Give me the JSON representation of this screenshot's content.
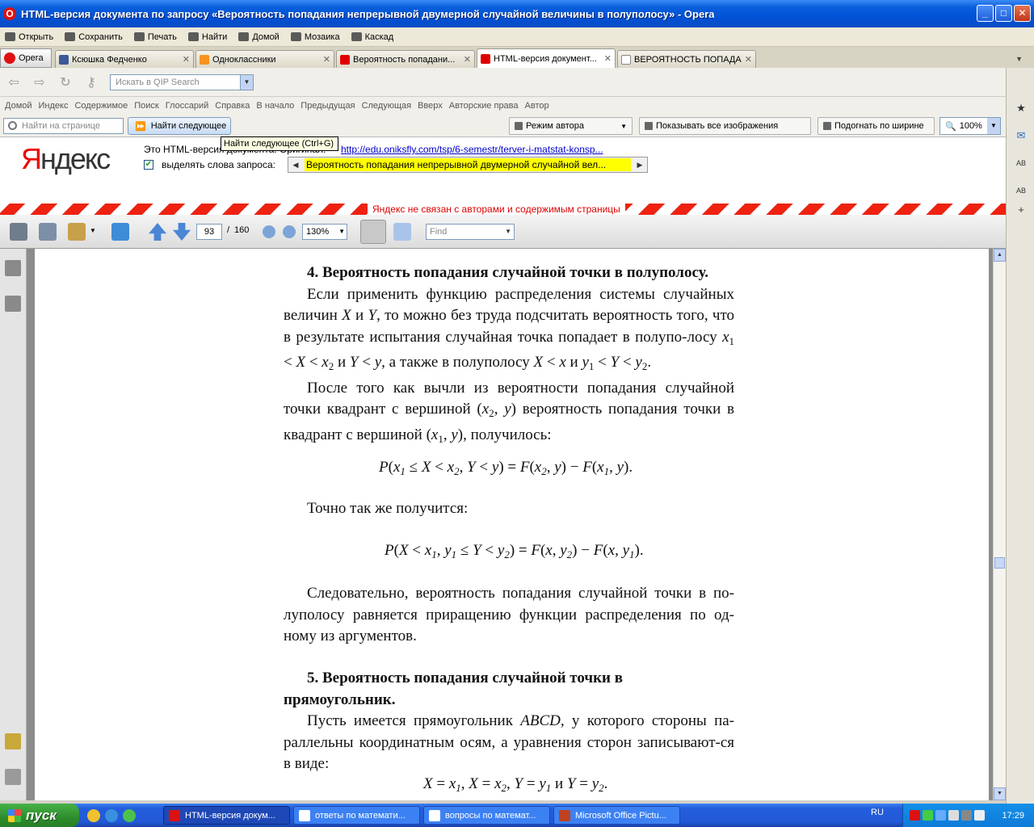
{
  "window": {
    "title": "HTML-версия документа по запросу «Вероятность попадания непрерывной двумерной случайной величины в полуполосу» - Opera"
  },
  "menubar": {
    "items": [
      "Открыть",
      "Сохранить",
      "Печать",
      "Найти",
      "Домой",
      "Мозаика",
      "Каскад"
    ]
  },
  "tabs": {
    "opera_label": "Opera",
    "items": [
      {
        "label": "Ксюшка Федченко",
        "color": "#3b5998"
      },
      {
        "label": "Одноклассники",
        "color": "#f7931e"
      },
      {
        "label": "Вероятность попадани...",
        "color": "#e00000"
      },
      {
        "label": "HTML-версия документ...",
        "color": "#e00000"
      },
      {
        "label": "ВЕРОЯТНОСТЬ ПОПАДА...",
        "color": "#888888"
      }
    ]
  },
  "navbar": {
    "search_placeholder": "Искать в QIP Search"
  },
  "sitelinks": [
    "Домой",
    "Индекс",
    "Содержимое",
    "Поиск",
    "Глоссарий",
    "Справка",
    "В начало",
    "Предыдущая",
    "Следующая",
    "Вверх",
    "Авторские права",
    "Автор"
  ],
  "findbar": {
    "placeholder": "Найти на странице",
    "find_next": "Найти следующее",
    "tooltip": "Найти следующее (Ctrl+G)",
    "author_mode": "Режим автора",
    "show_images": "Показывать все изображения",
    "fit_width": "Подогнать по ширине",
    "zoom": "100%"
  },
  "yandex": {
    "logo_r": "Я",
    "logo_rest": "ндекс",
    "html_version_text": "Это HTML-версия документа. Оригинал:",
    "url": "http://edu.oniksfly.com/tsp/6-semestr/terver-i-matstat-konsp...",
    "highlight_label": "выделять слова запроса:",
    "query": "Вероятность попадания непрерывной двумерной случайной вел...",
    "disclaimer": "Яндекс не связан с авторами и содержимым страницы"
  },
  "pdf": {
    "page": "93",
    "separator": "/",
    "total": "160",
    "zoom": "130%",
    "find_placeholder": "Find"
  },
  "document": {
    "heading4": "4. Вероятность попадания случайной точки в полуполосу.",
    "p1": "Если применить функцию распределения системы случайных величин",
    "p1_b": "и",
    "p1_c": ", то можно без труда подсчитать вероятность того, что в результате испытания случайная точка попадает в полупо-лосу",
    "p1_d": ", а также в полуполосу",
    "p2": "После того как вычли из вероятности попадания случайной точки квадрант с вершиной",
    "p2_b": "вероятность попадания точки в квадрант с вершиной",
    "p2_c": ", получилось:",
    "p3": "Точно так же получится:",
    "p4": "Следовательно, вероятность попадания случайной точки в по-луполосу равняется приращению функции распределения по од-ному из аргументов.",
    "heading5": "5. Вероятность попадания случайной точки в прямоугольник.",
    "p5_a": "Пусть имеется прямоугольник",
    "p5_abcd": "ABCD,",
    "p5_b": "у которого стороны па-раллельны координатным осям, а уравнения сторон записывают-ся в виде:"
  },
  "taskbar": {
    "start": "пуск",
    "tasks": [
      {
        "label": "HTML-версия докум...",
        "color": "#d11"
      },
      {
        "label": "ответы по математи...",
        "color": "#2b5bbf"
      },
      {
        "label": "вопросы по математ...",
        "color": "#2b5bbf"
      },
      {
        "label": "Microsoft Office Pictu...",
        "color": "#c04020"
      }
    ],
    "lang": "RU",
    "clock": "17:29"
  }
}
